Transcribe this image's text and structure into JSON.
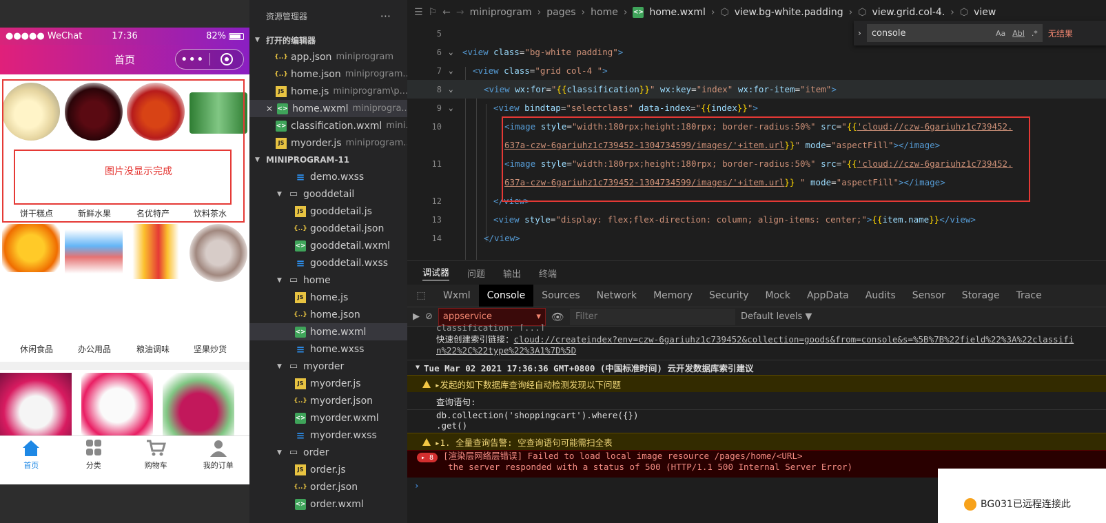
{
  "phone": {
    "carrier": "●●●●● WeChat",
    "time": "17:36",
    "battery": "82%",
    "nav_title": "首页",
    "capsule_dots": "•••",
    "error_note": "图片没显示完成",
    "row1_labels": [
      "饼干糕点",
      "新鲜水果",
      "名优特产",
      "饮料茶水"
    ],
    "row2_labels": [
      "休闲食品",
      "办公用品",
      "粮油调味",
      "坚果炒货"
    ],
    "tabs": [
      "首页",
      "分类",
      "购物车",
      "我的订单"
    ],
    "colors": {
      "nav_gradient_start": "#e0207a",
      "nav_gradient_end": "#8a1fc2",
      "active_tab": "#1e88e5",
      "error": "#e53935"
    }
  },
  "explorer": {
    "title": "资源管理器",
    "more": "···",
    "open_editors_title": "打开的编辑器",
    "open_editors": [
      {
        "name": "app.json",
        "desc": "miniprogram",
        "icon": "json"
      },
      {
        "name": "home.json",
        "desc": "miniprogram...",
        "icon": "json"
      },
      {
        "name": "home.js",
        "desc": "miniprogram\\p...",
        "icon": "js"
      },
      {
        "name": "home.wxml",
        "desc": "miniprogra...",
        "icon": "wxml"
      },
      {
        "name": "classification.wxml",
        "desc": "mini...",
        "icon": "wxml"
      },
      {
        "name": "myorder.js",
        "desc": "miniprogram...",
        "icon": "js"
      }
    ],
    "project_title": "MINIPROGRAM-11",
    "tree": [
      {
        "name": "demo.wxss",
        "icon": "wxss",
        "depth": 2
      },
      {
        "name": "gooddetail",
        "icon": "folder",
        "depth": 1
      },
      {
        "name": "gooddetail.js",
        "icon": "js",
        "depth": 2
      },
      {
        "name": "gooddetail.json",
        "icon": "json",
        "depth": 2
      },
      {
        "name": "gooddetail.wxml",
        "icon": "wxml",
        "depth": 2
      },
      {
        "name": "gooddetail.wxss",
        "icon": "wxss",
        "depth": 2
      },
      {
        "name": "home",
        "icon": "folder",
        "depth": 1
      },
      {
        "name": "home.js",
        "icon": "js",
        "depth": 2
      },
      {
        "name": "home.json",
        "icon": "json",
        "depth": 2
      },
      {
        "name": "home.wxml",
        "icon": "wxml",
        "depth": 2
      },
      {
        "name": "home.wxss",
        "icon": "wxss",
        "depth": 2
      },
      {
        "name": "myorder",
        "icon": "folder",
        "depth": 1
      },
      {
        "name": "myorder.js",
        "icon": "js",
        "depth": 2
      },
      {
        "name": "myorder.json",
        "icon": "json",
        "depth": 2
      },
      {
        "name": "myorder.wxml",
        "icon": "wxml",
        "depth": 2
      },
      {
        "name": "myorder.wxss",
        "icon": "wxss",
        "depth": 2
      },
      {
        "name": "order",
        "icon": "folder",
        "depth": 1
      },
      {
        "name": "order.js",
        "icon": "js",
        "depth": 2
      },
      {
        "name": "order.json",
        "icon": "json",
        "depth": 2
      },
      {
        "name": "order.wxml",
        "icon": "wxml",
        "depth": 2
      }
    ]
  },
  "editor": {
    "breadcrumb": [
      "miniprogram",
      "pages",
      "home",
      "home.wxml",
      "view.bg-white.padding",
      "view.grid.col-4.",
      "view"
    ],
    "find": {
      "query": "console",
      "case_label": "Aa",
      "word_label": "Abl",
      "regex_label": ".*",
      "result": "无结果"
    },
    "line_numbers": [
      "5",
      "6",
      "7",
      "8",
      "9",
      "10",
      "",
      "11",
      "",
      "12",
      "13",
      "14"
    ],
    "code": {
      "l6": [
        "<view ",
        "class",
        "=",
        "\"bg-white padding\"",
        ">"
      ],
      "l7": [
        "<view ",
        "class",
        "=",
        "\"grid col-4 \"",
        ">"
      ],
      "l8": [
        "<view ",
        "wx:for",
        "=",
        "\"",
        "{{",
        "classification",
        "}}",
        "\" ",
        "wx:key",
        "=",
        "\"index\" ",
        "wx:for-item",
        "=",
        "\"item\"",
        ">"
      ],
      "l9": [
        "<view ",
        "bindtap",
        "=",
        "\"selectclass\" ",
        "data-index",
        "=",
        "\"",
        "{{",
        "index",
        "}}",
        "\"",
        ">"
      ],
      "l10a": [
        "<image ",
        "style",
        "=",
        "\"width:180rpx;height:180rpx; border-radius:50%\" ",
        "src",
        "=",
        "\"",
        "{{",
        "'cloud://czw-6gariuhz1c739452."
      ],
      "l10b": [
        "637a-czw-6gariuhz1c739452-1304734599/images/'+item.url",
        "}}",
        "\" ",
        "mode",
        "=",
        "\"aspectFill\"",
        "></image>"
      ],
      "l11a": [
        "<image ",
        "style",
        "=",
        "\"width:180rpx;height:180rpx; border-radius:50%\" ",
        "src",
        "=",
        "\"",
        "{{",
        "'cloud://czw-6gariuhz1c739452."
      ],
      "l11b": [
        "637a-czw-6gariuhz1c739452-1304734599/images/'+item.url",
        "}}",
        " \" ",
        "mode",
        "=",
        "\"aspectFill\"",
        "></image>"
      ],
      "l12": [
        "</view>"
      ],
      "l13": [
        "<view ",
        "style",
        "=",
        "\"display: flex;flex-direction: column; align-items: center;\"",
        ">",
        "{{",
        "item.name",
        "}}",
        "</view>"
      ],
      "l14": [
        "</view>"
      ]
    }
  },
  "panel": {
    "tabs": [
      "调试器",
      "问题",
      "输出",
      "终端"
    ],
    "devtools_tabs": [
      "Wxml",
      "Console",
      "Sources",
      "Network",
      "Memory",
      "Security",
      "Mock",
      "AppData",
      "Audits",
      "Sensor",
      "Storage",
      "Trace"
    ],
    "context": "appservice",
    "filter_placeholder": "Filter",
    "levels": "Default levels ▼",
    "console": {
      "clipped": "classification: [...]",
      "index_link_label": "快速创建索引链接：",
      "index_link_1": "cloud://createindex?env=czw-6gariuhz1c739452&collection=goods&from=console&s=%5B%7B%22field%22%3A%22classifi",
      "index_link_2": "n%22%2C%22type%22%3A1%7D%5D",
      "group_header": "Tue Mar 02 2021 17:36:36 GMT+0800 (中国标准时间) 云开发数据库索引建议",
      "warn1": "▸发起的如下数据库查询经自动检测发现以下问题",
      "query_label": "查询语句:",
      "query_1": "db.collection('shoppingcart').where({})",
      "query_2": ".get()",
      "warn2": "▸1. 全量查询告警: 空查询语句可能需扫全表",
      "err_count": "▸ 8",
      "err_1": "[渲染层网络层错误] Failed to load local image resource /pages/home/<URL>",
      "err_2": "the server responded with a status of 500 (HTTP/1.1 500 Internal Server Error)",
      "prompt": "›"
    }
  },
  "toast": {
    "text": "BG031已远程连接此"
  }
}
